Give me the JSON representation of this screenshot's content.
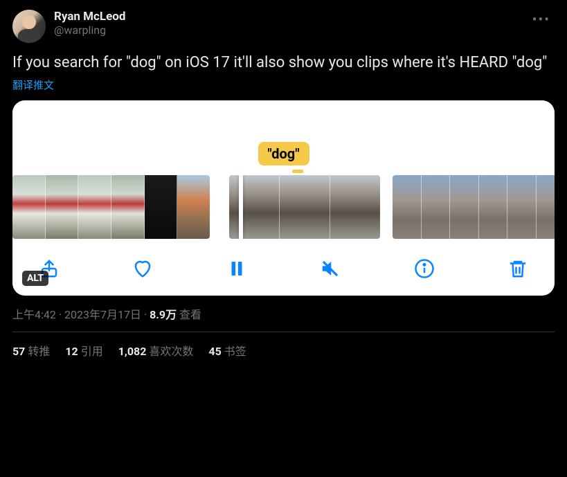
{
  "author": {
    "display_name": "Ryan McLeod",
    "handle": "@warpling"
  },
  "tweet_text": "If you search for \"dog\" on iOS 17 it'll also show you clips where it's HEARD \"dog\"",
  "translate_label": "翻译推文",
  "media": {
    "badge_text": "\"dog\"",
    "alt_label": "ALT",
    "toolbar": {
      "share": "share",
      "like": "like",
      "pause": "pause",
      "mute": "mute",
      "info": "info",
      "delete": "delete"
    }
  },
  "meta": {
    "time": "上午4:42",
    "date": "2023年7月17日",
    "views_count": "8.9万",
    "views_label": "查看",
    "separator": " · "
  },
  "stats": {
    "retweets": {
      "count": "57",
      "label": "转推"
    },
    "quotes": {
      "count": "12",
      "label": "引用"
    },
    "likes": {
      "count": "1,082",
      "label": "喜欢次数"
    },
    "bookmarks": {
      "count": "45",
      "label": "书签"
    }
  }
}
